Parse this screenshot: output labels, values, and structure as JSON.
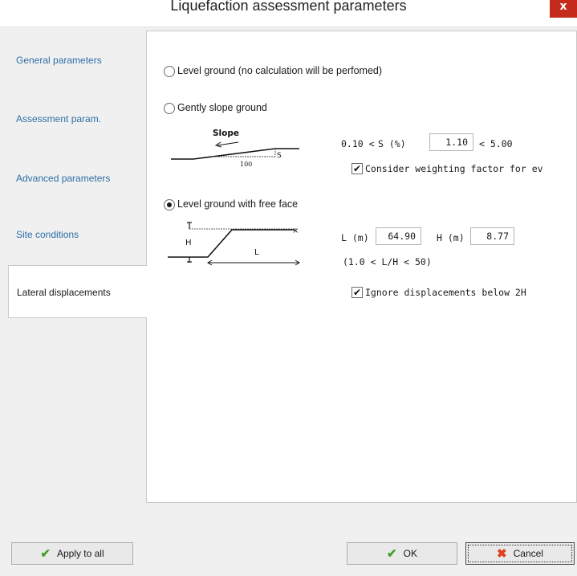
{
  "window": {
    "title": "Liquefaction assessment parameters",
    "close_glyph": "x"
  },
  "sidebar": {
    "items": [
      {
        "label": "General parameters"
      },
      {
        "label": "Assessment param."
      },
      {
        "label": "Advanced parameters"
      },
      {
        "label": "Site conditions"
      },
      {
        "label": "Lateral displacements",
        "active": true
      }
    ]
  },
  "options": {
    "level_ground": {
      "label": "Level ground (no calculation will be perfomed)",
      "selected": false
    },
    "gently_slope": {
      "label": "Gently slope ground",
      "selected": false,
      "diagram": {
        "title": "Slope",
        "s_label": "S",
        "run_label": "100"
      },
      "s_prefix": "0.10 <",
      "s_label": "S (%)",
      "s_value": "1.10",
      "s_suffix": "< 5.00",
      "weighting_checkbox": {
        "label": "Consider weighting factor for ev",
        "checked": true
      }
    },
    "free_face": {
      "label": "Level ground with free face",
      "selected": true,
      "diagram": {
        "h_label": "H",
        "l_label": "L"
      },
      "l_label": "L (m)",
      "l_value": "64.90",
      "h_label": "H (m)",
      "h_value": "8.77",
      "range_note": "(1.0 < L/H < 50)",
      "ignore_checkbox": {
        "label": "Ignore displacements below 2H",
        "checked": true
      }
    }
  },
  "footer": {
    "apply_all_label": "Apply to all",
    "ok_label": "OK",
    "cancel_label": "Cancel"
  },
  "colors": {
    "link": "#2e6ea6",
    "close": "#c42b1c",
    "ok_check": "#3fa02b",
    "cancel_x": "#e04020"
  },
  "icons": {
    "apply_all": "check-icon",
    "ok": "check-icon",
    "cancel": "cross-icon"
  }
}
